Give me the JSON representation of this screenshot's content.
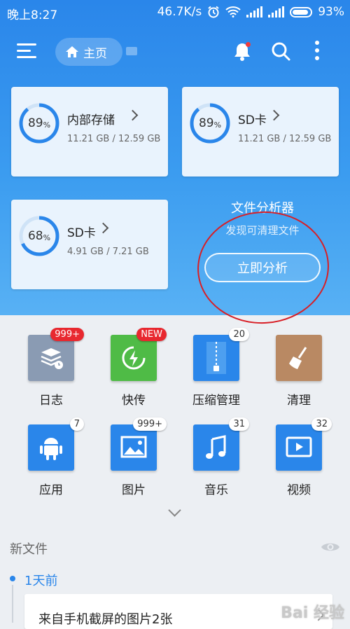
{
  "status_bar": {
    "time": "晚上8:27",
    "speed": "46.7K/s",
    "battery": "93%"
  },
  "header": {
    "home_label": "主页"
  },
  "storage_cards": [
    {
      "name": "内部存储",
      "percent": "89",
      "percent_unit": "%",
      "size": "11.21 GB / 12.59 GB",
      "fraction": 0.89
    },
    {
      "name": "SD卡",
      "percent": "89",
      "percent_unit": "%",
      "size": "11.21 GB / 12.59 GB",
      "fraction": 0.89
    },
    {
      "name": "SD卡",
      "percent": "68",
      "percent_unit": "%",
      "size": "4.91 GB / 7.21 GB",
      "fraction": 0.68
    }
  ],
  "analyzer": {
    "title": "文件分析器",
    "subtitle": "发现可清理文件",
    "button": "立即分析"
  },
  "grid": [
    {
      "label": "日志",
      "badge": "999+",
      "icon": "log-icon"
    },
    {
      "label": "快传",
      "badge": "NEW",
      "icon": "transfer-icon"
    },
    {
      "label": "压缩管理",
      "badge": "20",
      "icon": "zip-icon"
    },
    {
      "label": "清理",
      "badge": "",
      "icon": "broom-icon"
    },
    {
      "label": "应用",
      "badge": "7",
      "icon": "android-icon"
    },
    {
      "label": "图片",
      "badge": "999+",
      "icon": "image-icon"
    },
    {
      "label": "音乐",
      "badge": "31",
      "icon": "music-icon"
    },
    {
      "label": "视频",
      "badge": "32",
      "icon": "video-icon"
    }
  ],
  "new_files": {
    "title": "新文件",
    "date": "1天前",
    "item_title": "来自手机截屏的图片2张"
  },
  "watermark": "Bai 经验",
  "colors": {
    "primary": "#2a86ea",
    "badge_red": "#e8282f",
    "annotation_red": "#d81f26"
  }
}
